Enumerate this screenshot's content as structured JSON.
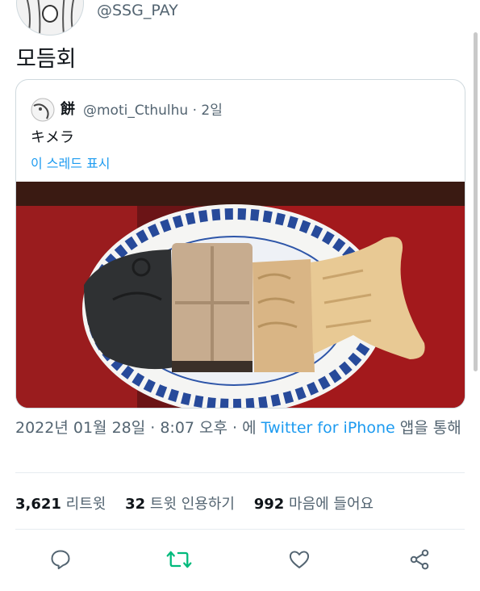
{
  "author": {
    "handle": "@SSG_PAY"
  },
  "tweet": {
    "text": "모듬회"
  },
  "quote": {
    "name": "餅",
    "handle": "@moti_Cthulhu · 2일",
    "text": "キメラ",
    "thread_link": "이 스레드 표시"
  },
  "meta": {
    "date": "2022년 01월 28일 · 8:07 오후 · 에",
    "source": "Twitter for iPhone",
    "suffix": "앱을 통해"
  },
  "stats": {
    "retweets_count": "3,621",
    "retweets_label": "리트윗",
    "quotes_count": "32",
    "quotes_label": "트윗 인용하기",
    "likes_count": "992",
    "likes_label": "마음에 들어요"
  },
  "colors": {
    "accent": "#1d9bf0",
    "retweet_green": "#00ba7c",
    "secondary": "#536471"
  },
  "actions": [
    "reply-icon",
    "retweet-icon",
    "like-icon",
    "share-icon"
  ]
}
